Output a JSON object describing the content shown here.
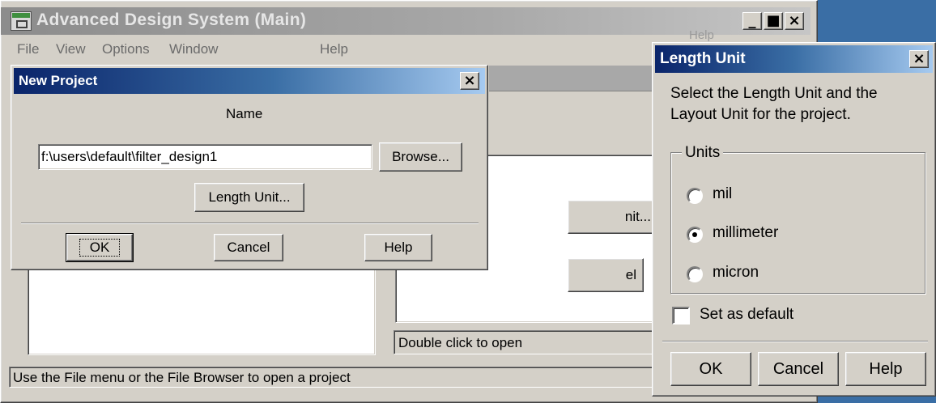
{
  "main": {
    "title": "Advanced Design System (Main)",
    "menu": [
      "File",
      "View",
      "Options",
      "Window",
      "Help"
    ],
    "status": "Use the File menu or the File Browser to open a project",
    "hint": "Double click to open",
    "bg_button_partial": "nit...",
    "bg_button_partial2": "el",
    "bg_help_partial": "Help"
  },
  "new_project": {
    "title": "New Project",
    "name_label": "Name",
    "name_value": "f:\\users\\default\\filter_design1",
    "browse": "Browse...",
    "length_unit": "Length Unit...",
    "ok": "OK",
    "cancel": "Cancel",
    "help": "Help"
  },
  "length_unit": {
    "title": "Length Unit",
    "description": "Select the Length Unit and the Layout Unit for the project.",
    "group_label": "Units",
    "options": [
      {
        "label": "mil",
        "selected": false
      },
      {
        "label": "millimeter",
        "selected": true
      },
      {
        "label": "micron",
        "selected": false
      }
    ],
    "set_default_label": "Set as default",
    "set_default_checked": false,
    "ok": "OK",
    "cancel": "Cancel",
    "help": "Help"
  },
  "colors": {
    "face": "#d4d0c8",
    "active_title_start": "#0a246a",
    "active_title_end": "#a6caf0",
    "inactive_title": "#8c8c8c"
  }
}
